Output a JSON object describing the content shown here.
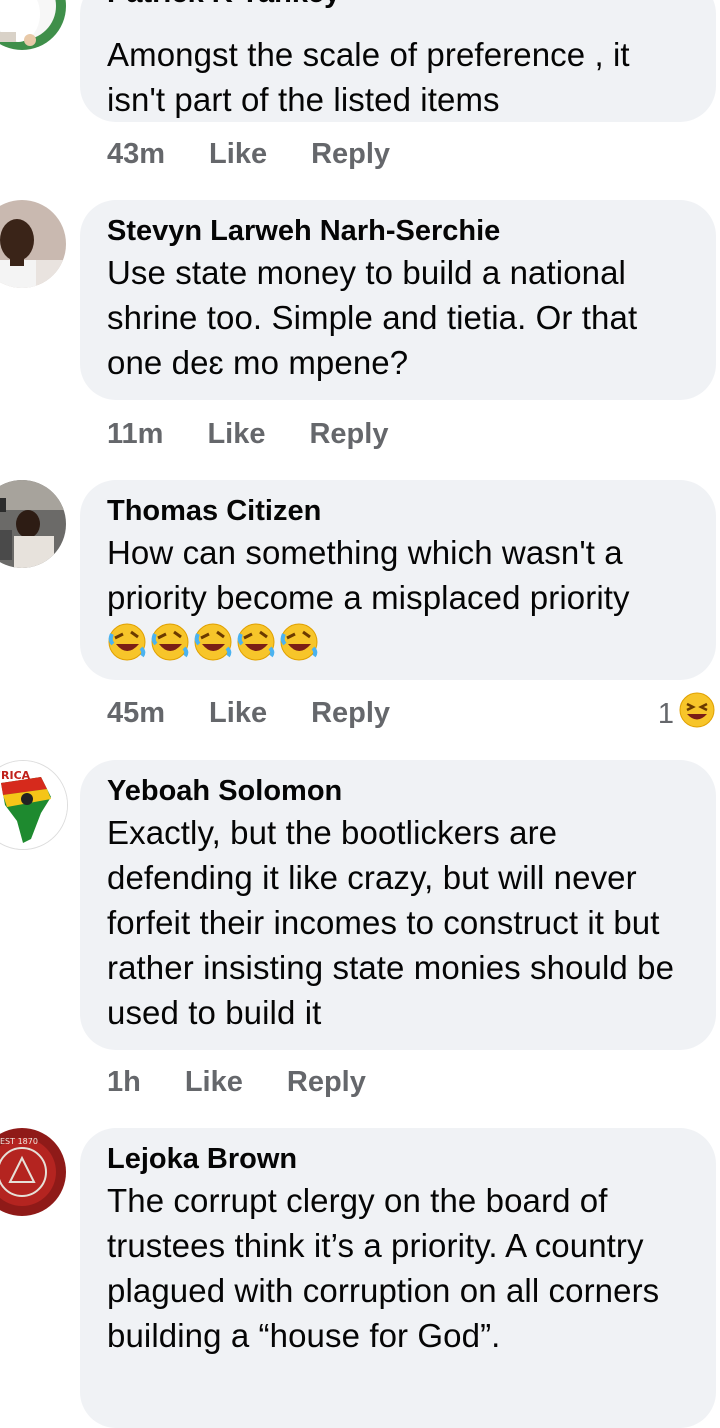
{
  "comments": [
    {
      "author": "Patrick K Yankey",
      "text": "Amongst the scale of preference , it isn't part of the listed items",
      "time": "43m",
      "like": "Like",
      "reply": "Reply"
    },
    {
      "author": "Stevyn Larweh Narh-Serchie",
      "text": "Use state money to build a national shrine too. Simple and tietia. Or that one deɛ mo mpene?",
      "time": "11m",
      "like": "Like",
      "reply": "Reply"
    },
    {
      "author": "Thomas Citizen",
      "text": "How can something which wasn't a priority become a misplaced priority",
      "emoji": "🤣🤣🤣🤣🤣",
      "time": "45m",
      "like": "Like",
      "reply": "Reply",
      "reaction_count": "1",
      "reaction_icon": "laughing-emoji-icon"
    },
    {
      "author": "Yeboah Solomon",
      "text": "Exactly, but the bootlickers are defending it like crazy, but will never forfeit their incomes to construct it but rather insisting state monies should be used to build it",
      "avatar_text": "AFRICA",
      "time": "1h",
      "like": "Like",
      "reply": "Reply"
    },
    {
      "author": "Lejoka Brown",
      "text": "The corrupt clergy on the board of trustees think it’s a priority. A country plagued with corruption on all corners building a “house for God”.",
      "avatar_text": "EST 1870"
    }
  ],
  "colors": {
    "bubble": "#f0f2f5",
    "meta_text": "#65676b",
    "body_text": "#050505"
  }
}
